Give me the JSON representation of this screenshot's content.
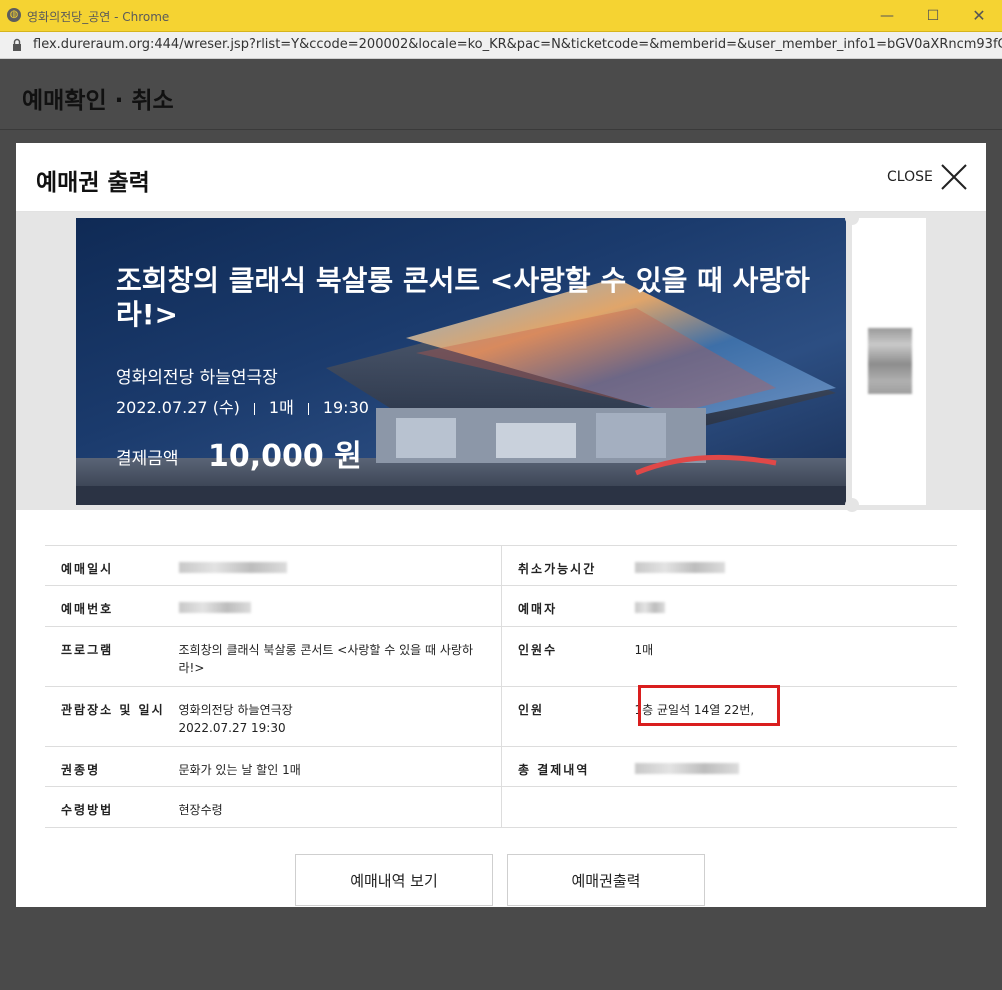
{
  "window": {
    "title": "영화의전당_공연 - Chrome",
    "url": "flex.dureraum.org:444/wreser.jsp?rlist=Y&ccode=200002&locale=ko_KR&pac=N&ticketcode=&memberid=&user_member_info1=bGV0aXRncm93fC..."
  },
  "page": {
    "title": "예매확인 · 취소"
  },
  "modal": {
    "title": "예매권 출력",
    "close_label": "CLOSE"
  },
  "banner": {
    "show_title": "조희창의 클래식 북살롱 콘서트 <사랑할 수 있을 때 사랑하라!>",
    "venue": "영화의전당 하늘연극장",
    "date": "2022.07.27 (수)",
    "count": "1매",
    "time": "19:30",
    "pay_label": "결제금액",
    "pay_amount": "10,000 원"
  },
  "info": {
    "booking_date_label": "예매일시",
    "cancel_deadline_label": "취소가능시간",
    "booking_no_label": "예매번호",
    "booker_label": "예매자",
    "program_label": "프로그램",
    "program_value": "조희창의 클래식 북살롱 콘서트 <사랑할 수 있을 때 사랑하라!>",
    "headcount_label": "인원수",
    "headcount_value": "1매",
    "venue_label": "관람장소 및 일시",
    "venue_value": "영화의전당 하늘연극장",
    "venue_datetime": "2022.07.27 19:30",
    "seat_label": "인원",
    "seat_value": "1층 균일석 14열 22번,",
    "ticket_type_label": "권종명",
    "ticket_type_value": "문화가 있는 날 할인 1매",
    "total_label": "총 결제내역",
    "pickup_label": "수령방법",
    "pickup_value": "현장수령"
  },
  "buttons": {
    "view_history": "예매내역 보기",
    "print_ticket": "예매권출력"
  }
}
